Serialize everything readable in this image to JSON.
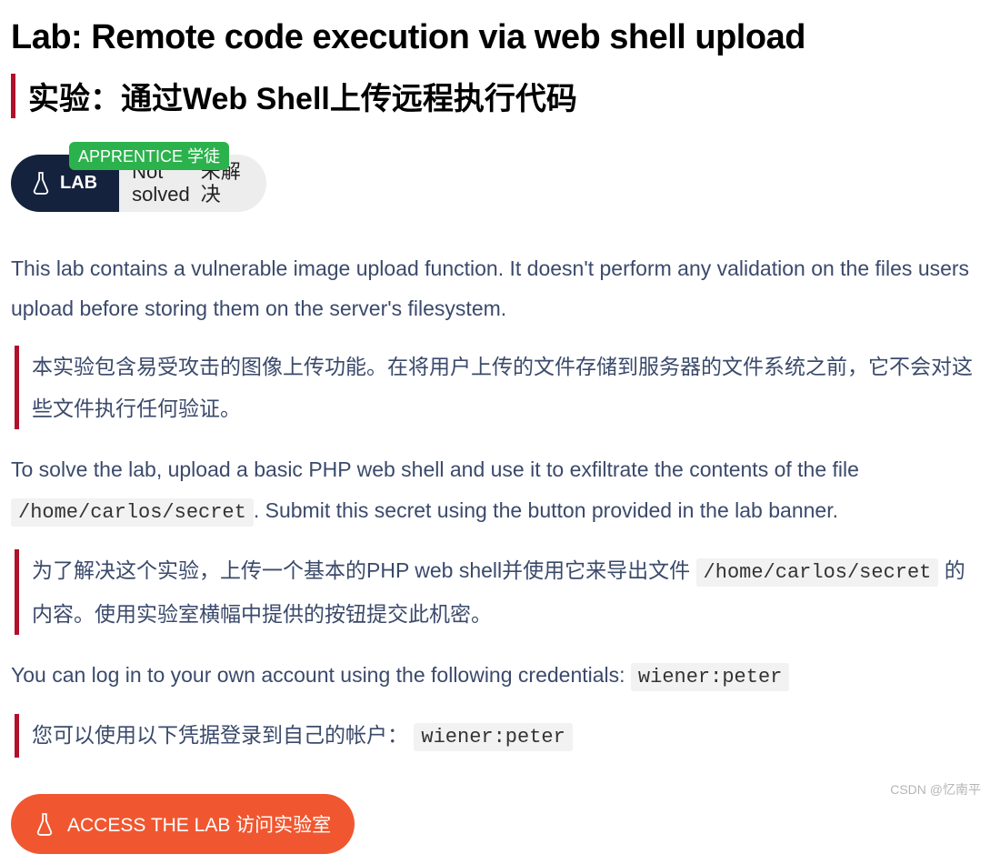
{
  "title_en": "Lab: Remote code execution via web shell upload",
  "title_zh": "实验：通过Web Shell上传远程执行代码",
  "badge": {
    "apprentice": "APPRENTICE 学徒",
    "lab": "LAB"
  },
  "status": {
    "not_en": "Not",
    "solved_en": "solved",
    "not_zh": "未解",
    "solved_zh": "决"
  },
  "p1_en": "This lab contains a vulnerable image upload function. It doesn't perform any validation on the files users upload before storing them on the server's filesystem.",
  "p1_zh": "本实验包含易受攻击的图像上传功能。在将用户上传的文件存储到服务器的文件系统之前，它不会对这些文件执行任何验证。",
  "p2_en_a": "To solve the lab, upload a basic PHP web shell and use it to exfiltrate the contents of the file ",
  "secret_path": "/home/carlos/secret",
  "p2_en_b": ". Submit this secret using the button provided in the lab banner.",
  "p2_zh_a": "为了解决这个实验，上传一个基本的PHP web shell并使用它来导出文件 ",
  "p2_zh_b": " 的内容。使用实验室横幅中提供的按钮提交此机密。",
  "p3_en": "You can log in to your own account using the following credentials: ",
  "creds": "wiener:peter",
  "p3_zh": "您可以使用以下凭据登录到自己的帐户： ",
  "access_label": "ACCESS THE LAB 访问实验室",
  "watermark": "CSDN @忆南平"
}
